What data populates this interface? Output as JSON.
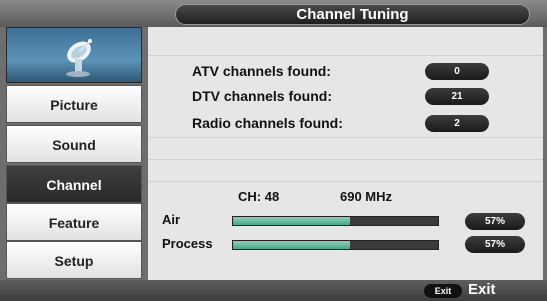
{
  "header": {
    "title": "Channel Tuning"
  },
  "sidebar": {
    "logo_icon": "satellite-dish-icon",
    "items": [
      {
        "label": "Picture"
      },
      {
        "label": "Sound"
      },
      {
        "label": "Channel"
      },
      {
        "label": "Feature"
      },
      {
        "label": "Setup"
      }
    ],
    "active_item": "Channel"
  },
  "results": {
    "atv": {
      "label": "ATV channels found:",
      "value": "0"
    },
    "dtv": {
      "label": "DTV channels found:",
      "value": "21"
    },
    "radio": {
      "label": "Radio channels found:",
      "value": "2"
    }
  },
  "scan": {
    "channel": "CH: 48",
    "frequency": "690 MHz",
    "air": {
      "label": "Air",
      "percent_text": "57%",
      "progress": 0.57
    },
    "process": {
      "label": "Process",
      "percent_text": "57%",
      "progress": 0.57
    }
  },
  "footer": {
    "exit_key": "Exit",
    "exit_label": "Exit"
  },
  "colors": {
    "bar_fill": "#4aa88a",
    "panel": "#e6e6e6",
    "active_menu": "#2a2a2a"
  }
}
